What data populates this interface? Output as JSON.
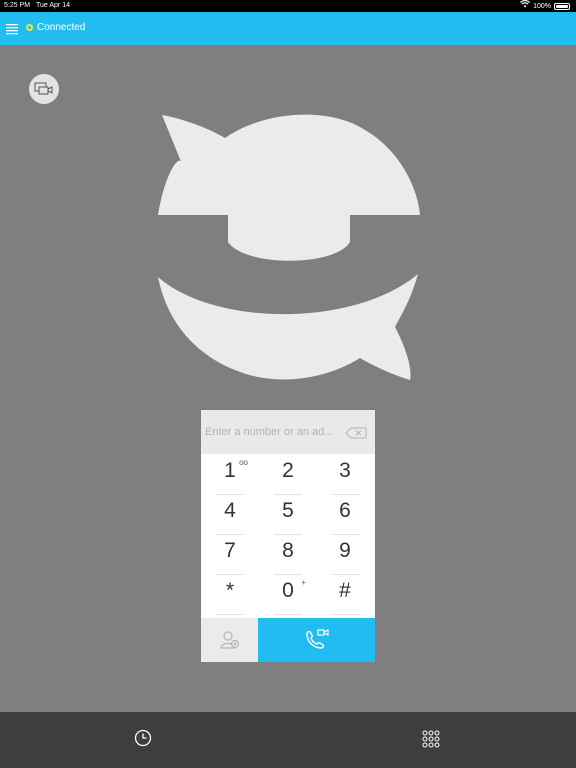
{
  "status_bar": {
    "time": "5:25 PM",
    "date": "Tue Apr 14",
    "battery": "100%",
    "wifi_icon": "wifi-icon",
    "battery_icon": "battery-icon"
  },
  "header": {
    "menu_icon": "hamburger-menu-icon",
    "connection_status": "Connected",
    "status_color": "#f2e23a",
    "bar_color": "#22bdf0"
  },
  "selfview": {
    "icon": "selfview-camera-icon"
  },
  "logo": {
    "icon": "chat-bubbles-logo-icon"
  },
  "dialer": {
    "placeholder": "Enter a number or an ad...",
    "value": "",
    "backspace_icon": "backspace-icon",
    "keys": [
      {
        "digit": "1",
        "sub": "oo"
      },
      {
        "digit": "2",
        "sub": ""
      },
      {
        "digit": "3",
        "sub": ""
      },
      {
        "digit": "4",
        "sub": ""
      },
      {
        "digit": "5",
        "sub": ""
      },
      {
        "digit": "6",
        "sub": ""
      },
      {
        "digit": "7",
        "sub": ""
      },
      {
        "digit": "8",
        "sub": ""
      },
      {
        "digit": "9",
        "sub": ""
      },
      {
        "digit": "*",
        "sub": ""
      },
      {
        "digit": "0",
        "sub": "+"
      },
      {
        "digit": "#",
        "sub": ""
      }
    ],
    "contacts_icon": "add-contact-icon",
    "call_icon": "video-call-icon"
  },
  "bottom_bar": {
    "history_icon": "clock-icon",
    "keypad_icon": "keypad-grid-icon"
  }
}
